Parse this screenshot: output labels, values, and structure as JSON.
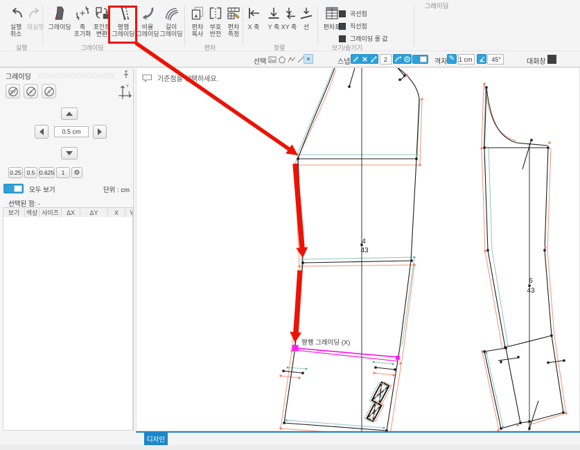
{
  "ribbon": {
    "tab_title": "그레이딩",
    "group_labels": {
      "run": "실행",
      "grading": "그레이딩",
      "deviation": "편차",
      "align": "정렬",
      "view": "보기/숨기기"
    },
    "buttons": {
      "undo": "실행\n취소",
      "redo": "재실행",
      "grading": "그레이딩",
      "axis_reset": "축\n초기화",
      "point_convert": "포인트\n변환",
      "parallel_grading": "평행\n그레이딩",
      "ratio_grading": "비율\n그레이딩",
      "length_grading": "길이\n그레이딩",
      "dev_copy": "편차\n복사",
      "sign_invert": "부호\n반전",
      "dev_measure": "편차\n측정",
      "align_x": "X 축",
      "align_y": "Y 축",
      "align_xy": "XY 축",
      "align_line": "선",
      "dev_table": "편차표"
    },
    "view_checks": [
      "곡선점",
      "직선점",
      "그레이딩 룰 값"
    ]
  },
  "toolbar": {
    "select_label": "선택",
    "snap_label": "스냅",
    "snap_tolerance": "2",
    "grid_label": "격자",
    "grid_size": "1 cm",
    "grid_angle": "45°",
    "dialog_label": "대화창"
  },
  "sidebar": {
    "title": "그레이딩",
    "axis_buttons": [
      "XY",
      "X",
      "Y"
    ],
    "step": "0.5 cm",
    "presets": [
      "0.25",
      "0.5",
      "0.625",
      "1"
    ],
    "show_all": "모두 보기",
    "unit": "단위 : cm",
    "selected": "선택된 점: -",
    "columns": [
      "보기",
      "색상",
      "사이즈",
      "ΔX",
      "ΔY",
      "X",
      "Y"
    ]
  },
  "canvas": {
    "hint": "기준점을 선택하세요.",
    "tooltip": "평행 그레이딩 (X)",
    "center_piece_no": "4",
    "center_piece_size": "43",
    "right_piece_no": "6",
    "right_piece_size": "43"
  },
  "tabs": {
    "design": "디자인"
  },
  "icons": {
    "gear": "⚙",
    "pencil": "✎",
    "axis_x_letter": "x",
    "axis_y_letter": "Y"
  },
  "colors": {
    "accent_blue": "#2ea2da",
    "annotation_red": "#eb1306",
    "magenta": "#ff00f0",
    "grade_teal": "#8fc6bf",
    "grade_salmon": "#f09478",
    "tab_blue": "#1d86c8"
  }
}
